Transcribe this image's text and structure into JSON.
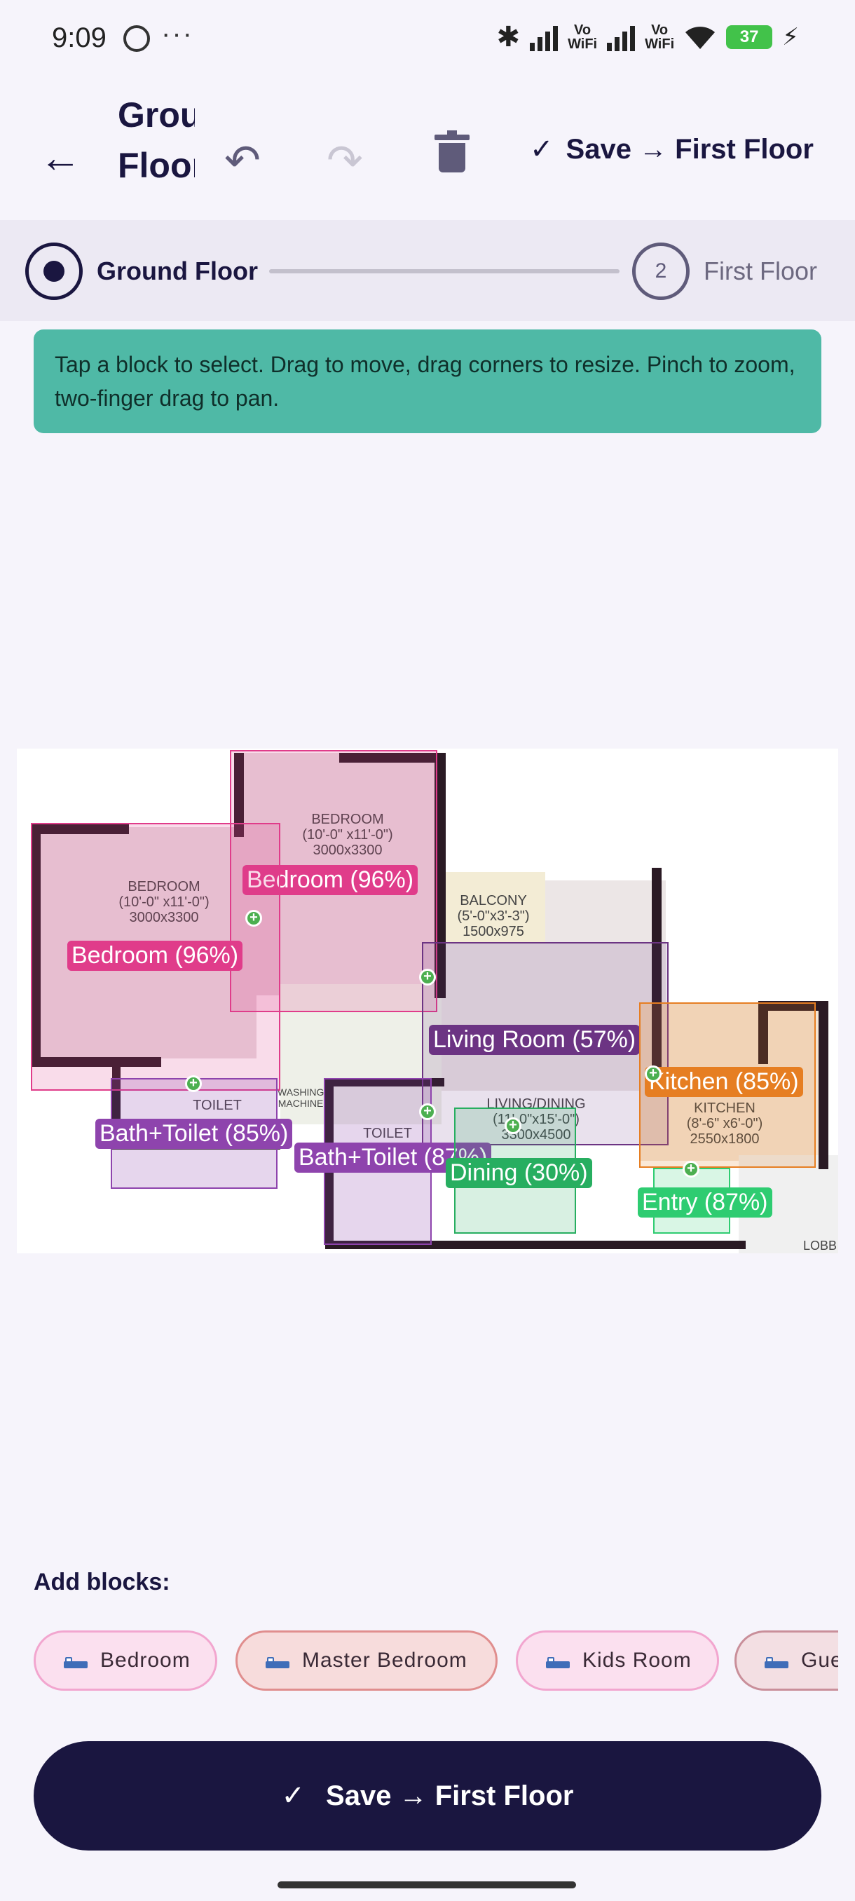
{
  "status_bar": {
    "time": "9:09",
    "dots": "···",
    "vowifi": "Vo\nWiFi",
    "battery": "37"
  },
  "app_bar": {
    "title": "Ground Floor",
    "save_label": "Save → First Floor"
  },
  "stepper": {
    "step1_label": "Ground Floor",
    "step2_number": "2",
    "step2_label": "First Floor"
  },
  "banner": {
    "text": "Tap a block to select. Drag to move, drag corners to resize. Pinch to zoom, two-finger drag to pan."
  },
  "plan": {
    "texts": {
      "bedroom_left": "BEDROOM\n(10'-0\" x11'-0\")\n3000x3300",
      "bedroom_top": "BEDROOM\n(10'-0\" x11'-0\")\n3000x3300",
      "balcony": "BALCONY\n(5'-0\"x3'-3\")\n1500x975",
      "toilet_left": "TOILET",
      "washing": "WASHING\nMACHINE",
      "toilet_mid": "TOILET",
      "living": "LIVING/DINING\n(11'-0\"x15'-0\")\n3300x4500",
      "kitchen": "KITCHEN\n(8'-6\" x6'-0\")\n2550x1800",
      "lobby": "LOBB"
    },
    "blocks": {
      "bedroom_top": "Bedroom (96%)",
      "bedroom_left": "Bedroom (96%)",
      "living": "Living Room (57%)",
      "kitchen": "Kitchen (85%)",
      "bath_left": "Bath+Toilet (85%)",
      "bath_mid": "Bath+Toilet (87%)",
      "dining": "Dining (30%)",
      "entry": "Entry (87%)"
    },
    "colors": {
      "bedroom": "#e03c8a",
      "bath": "#8e44ad",
      "living": "#6c3483",
      "kitchen": "#e67e22",
      "dining": "#27ae60",
      "entry": "#2ecc71"
    }
  },
  "add_blocks": {
    "title": "Add blocks:",
    "chips": [
      "Bedroom",
      "Master Bedroom",
      "Kids Room",
      "Guest Room"
    ]
  },
  "bottom_button": {
    "label": "Save → First Floor"
  }
}
